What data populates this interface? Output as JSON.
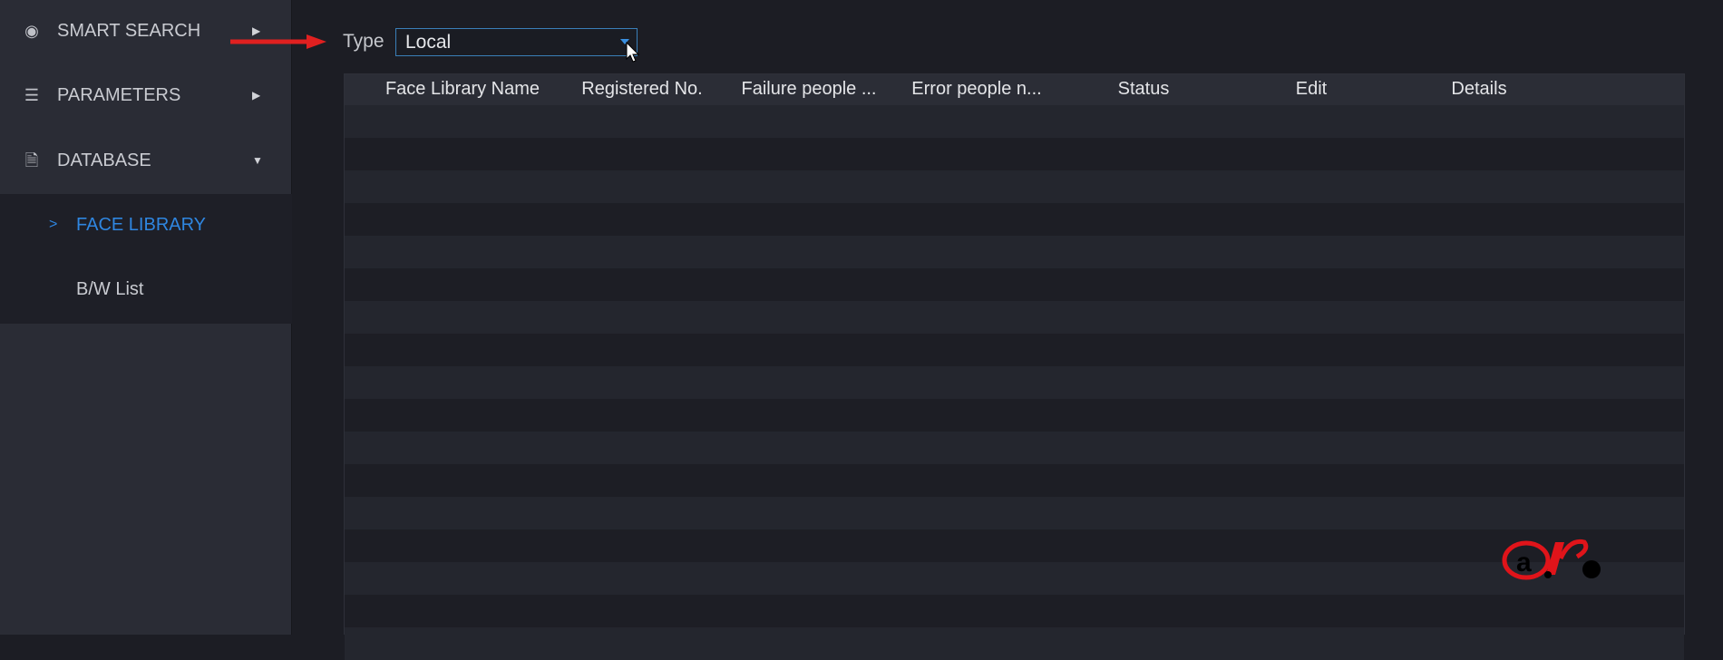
{
  "sidebar": {
    "items": [
      {
        "label": "SMART SEARCH",
        "icon": "smart-search-icon",
        "arrow": "caret-right"
      },
      {
        "label": "PARAMETERS",
        "icon": "list-icon",
        "arrow": "caret-right"
      },
      {
        "label": "DATABASE",
        "icon": "database-icon",
        "arrow": "caret-down"
      }
    ],
    "subitems": [
      {
        "label": "FACE LIBRARY",
        "active": true,
        "marker": ">"
      },
      {
        "label": "B/W List",
        "active": false
      }
    ]
  },
  "filter": {
    "type_label": "Type",
    "type_value": "Local"
  },
  "table": {
    "columns": [
      "Face Library Name",
      "Registered No.",
      "Failure people ...",
      "Error people n...",
      "Status",
      "Edit",
      "Details"
    ],
    "rows": []
  },
  "colors": {
    "accent": "#3a8fe0",
    "active_text": "#2f86e0",
    "annotation_arrow": "#e02020",
    "watermark": "#e0141a"
  },
  "watermark": {
    "text": "alp"
  }
}
